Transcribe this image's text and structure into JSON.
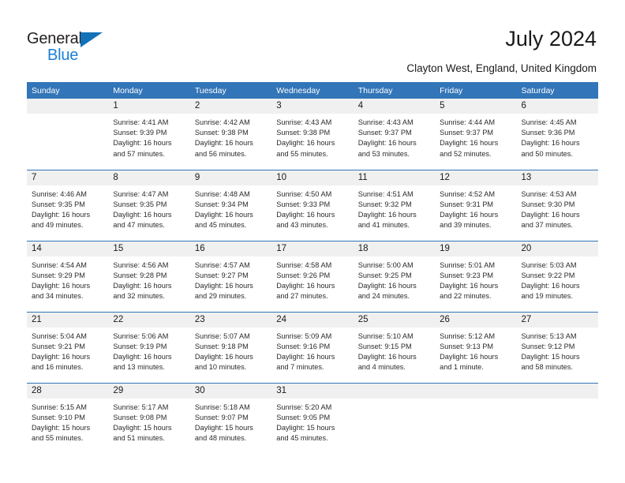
{
  "brand": {
    "name_top": "General",
    "name_bottom": "Blue",
    "triangle_color": "#1371b8",
    "blue_color": "#1b7fd4"
  },
  "header": {
    "title": "July 2024",
    "location": "Clayton West, England, United Kingdom"
  },
  "theme": {
    "header_bg": "#3275b8",
    "header_text": "#ffffff",
    "daynum_bg": "#f0f0f0",
    "separator": "#3275b8"
  },
  "calendar": {
    "weekday_headers": [
      "Sunday",
      "Monday",
      "Tuesday",
      "Wednesday",
      "Thursday",
      "Friday",
      "Saturday"
    ],
    "weeks": [
      [
        {
          "day": "",
          "empty": true,
          "lines": []
        },
        {
          "day": "1",
          "lines": [
            "Sunrise: 4:41 AM",
            "Sunset: 9:39 PM",
            "Daylight: 16 hours",
            "and 57 minutes."
          ]
        },
        {
          "day": "2",
          "lines": [
            "Sunrise: 4:42 AM",
            "Sunset: 9:38 PM",
            "Daylight: 16 hours",
            "and 56 minutes."
          ]
        },
        {
          "day": "3",
          "lines": [
            "Sunrise: 4:43 AM",
            "Sunset: 9:38 PM",
            "Daylight: 16 hours",
            "and 55 minutes."
          ]
        },
        {
          "day": "4",
          "lines": [
            "Sunrise: 4:43 AM",
            "Sunset: 9:37 PM",
            "Daylight: 16 hours",
            "and 53 minutes."
          ]
        },
        {
          "day": "5",
          "lines": [
            "Sunrise: 4:44 AM",
            "Sunset: 9:37 PM",
            "Daylight: 16 hours",
            "and 52 minutes."
          ]
        },
        {
          "day": "6",
          "lines": [
            "Sunrise: 4:45 AM",
            "Sunset: 9:36 PM",
            "Daylight: 16 hours",
            "and 50 minutes."
          ]
        }
      ],
      [
        {
          "day": "7",
          "lines": [
            "Sunrise: 4:46 AM",
            "Sunset: 9:35 PM",
            "Daylight: 16 hours",
            "and 49 minutes."
          ]
        },
        {
          "day": "8",
          "lines": [
            "Sunrise: 4:47 AM",
            "Sunset: 9:35 PM",
            "Daylight: 16 hours",
            "and 47 minutes."
          ]
        },
        {
          "day": "9",
          "lines": [
            "Sunrise: 4:48 AM",
            "Sunset: 9:34 PM",
            "Daylight: 16 hours",
            "and 45 minutes."
          ]
        },
        {
          "day": "10",
          "lines": [
            "Sunrise: 4:50 AM",
            "Sunset: 9:33 PM",
            "Daylight: 16 hours",
            "and 43 minutes."
          ]
        },
        {
          "day": "11",
          "lines": [
            "Sunrise: 4:51 AM",
            "Sunset: 9:32 PM",
            "Daylight: 16 hours",
            "and 41 minutes."
          ]
        },
        {
          "day": "12",
          "lines": [
            "Sunrise: 4:52 AM",
            "Sunset: 9:31 PM",
            "Daylight: 16 hours",
            "and 39 minutes."
          ]
        },
        {
          "day": "13",
          "lines": [
            "Sunrise: 4:53 AM",
            "Sunset: 9:30 PM",
            "Daylight: 16 hours",
            "and 37 minutes."
          ]
        }
      ],
      [
        {
          "day": "14",
          "lines": [
            "Sunrise: 4:54 AM",
            "Sunset: 9:29 PM",
            "Daylight: 16 hours",
            "and 34 minutes."
          ]
        },
        {
          "day": "15",
          "lines": [
            "Sunrise: 4:56 AM",
            "Sunset: 9:28 PM",
            "Daylight: 16 hours",
            "and 32 minutes."
          ]
        },
        {
          "day": "16",
          "lines": [
            "Sunrise: 4:57 AM",
            "Sunset: 9:27 PM",
            "Daylight: 16 hours",
            "and 29 minutes."
          ]
        },
        {
          "day": "17",
          "lines": [
            "Sunrise: 4:58 AM",
            "Sunset: 9:26 PM",
            "Daylight: 16 hours",
            "and 27 minutes."
          ]
        },
        {
          "day": "18",
          "lines": [
            "Sunrise: 5:00 AM",
            "Sunset: 9:25 PM",
            "Daylight: 16 hours",
            "and 24 minutes."
          ]
        },
        {
          "day": "19",
          "lines": [
            "Sunrise: 5:01 AM",
            "Sunset: 9:23 PM",
            "Daylight: 16 hours",
            "and 22 minutes."
          ]
        },
        {
          "day": "20",
          "lines": [
            "Sunrise: 5:03 AM",
            "Sunset: 9:22 PM",
            "Daylight: 16 hours",
            "and 19 minutes."
          ]
        }
      ],
      [
        {
          "day": "21",
          "lines": [
            "Sunrise: 5:04 AM",
            "Sunset: 9:21 PM",
            "Daylight: 16 hours",
            "and 16 minutes."
          ]
        },
        {
          "day": "22",
          "lines": [
            "Sunrise: 5:06 AM",
            "Sunset: 9:19 PM",
            "Daylight: 16 hours",
            "and 13 minutes."
          ]
        },
        {
          "day": "23",
          "lines": [
            "Sunrise: 5:07 AM",
            "Sunset: 9:18 PM",
            "Daylight: 16 hours",
            "and 10 minutes."
          ]
        },
        {
          "day": "24",
          "lines": [
            "Sunrise: 5:09 AM",
            "Sunset: 9:16 PM",
            "Daylight: 16 hours",
            "and 7 minutes."
          ]
        },
        {
          "day": "25",
          "lines": [
            "Sunrise: 5:10 AM",
            "Sunset: 9:15 PM",
            "Daylight: 16 hours",
            "and 4 minutes."
          ]
        },
        {
          "day": "26",
          "lines": [
            "Sunrise: 5:12 AM",
            "Sunset: 9:13 PM",
            "Daylight: 16 hours",
            "and 1 minute."
          ]
        },
        {
          "day": "27",
          "lines": [
            "Sunrise: 5:13 AM",
            "Sunset: 9:12 PM",
            "Daylight: 15 hours",
            "and 58 minutes."
          ]
        }
      ],
      [
        {
          "day": "28",
          "lines": [
            "Sunrise: 5:15 AM",
            "Sunset: 9:10 PM",
            "Daylight: 15 hours",
            "and 55 minutes."
          ]
        },
        {
          "day": "29",
          "lines": [
            "Sunrise: 5:17 AM",
            "Sunset: 9:08 PM",
            "Daylight: 15 hours",
            "and 51 minutes."
          ]
        },
        {
          "day": "30",
          "lines": [
            "Sunrise: 5:18 AM",
            "Sunset: 9:07 PM",
            "Daylight: 15 hours",
            "and 48 minutes."
          ]
        },
        {
          "day": "31",
          "lines": [
            "Sunrise: 5:20 AM",
            "Sunset: 9:05 PM",
            "Daylight: 15 hours",
            "and 45 minutes."
          ]
        },
        {
          "day": "",
          "empty": true,
          "lines": []
        },
        {
          "day": "",
          "empty": true,
          "lines": []
        },
        {
          "day": "",
          "empty": true,
          "lines": []
        }
      ]
    ]
  }
}
